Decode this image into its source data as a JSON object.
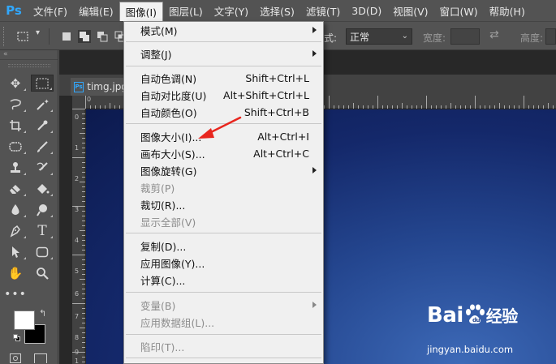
{
  "app": {
    "logo": "Ps"
  },
  "menubar": {
    "items": [
      {
        "label": "文件(F)"
      },
      {
        "label": "编辑(E)"
      },
      {
        "label": "图像(I)",
        "active": true
      },
      {
        "label": "图层(L)"
      },
      {
        "label": "文字(Y)"
      },
      {
        "label": "选择(S)"
      },
      {
        "label": "滤镜(T)"
      },
      {
        "label": "3D(D)"
      },
      {
        "label": "视图(V)"
      },
      {
        "label": "窗口(W)"
      },
      {
        "label": "帮助(H)"
      }
    ]
  },
  "options": {
    "style_label": "式:",
    "style_value": "正常",
    "width_label": "宽度:",
    "height_label": "高度:"
  },
  "document": {
    "tab_name": "timg.jpg",
    "ps_badge": "Ps",
    "ruler_top": [
      "0"
    ],
    "ruler_left": [
      "0",
      "1",
      "2",
      "3",
      "4",
      "5",
      "6",
      "7",
      "8",
      "9",
      "1"
    ]
  },
  "image_menu": {
    "mode": {
      "label": "模式(M)"
    },
    "adjust": {
      "label": "调整(J)"
    },
    "auto_tone": {
      "label": "自动色调(N)",
      "shortcut": "Shift+Ctrl+L"
    },
    "auto_contrast": {
      "label": "自动对比度(U)",
      "shortcut": "Alt+Shift+Ctrl+L"
    },
    "auto_color": {
      "label": "自动颜色(O)",
      "shortcut": "Shift+Ctrl+B"
    },
    "image_size": {
      "label": "图像大小(I)...",
      "shortcut": "Alt+Ctrl+I"
    },
    "canvas_size": {
      "label": "画布大小(S)...",
      "shortcut": "Alt+Ctrl+C"
    },
    "image_rotation": {
      "label": "图像旋转(G)"
    },
    "crop": {
      "label": "裁剪(P)"
    },
    "trim": {
      "label": "裁切(R)..."
    },
    "reveal_all": {
      "label": "显示全部(V)"
    },
    "duplicate": {
      "label": "复制(D)..."
    },
    "apply_image": {
      "label": "应用图像(Y)..."
    },
    "calculations": {
      "label": "计算(C)..."
    },
    "variables": {
      "label": "变量(B)"
    },
    "apply_data_set": {
      "label": "应用数据组(L)..."
    },
    "trap": {
      "label": "陷印(T)..."
    }
  },
  "watermark": {
    "brand": "Bai",
    "brand_suffix": "经验",
    "url": "jingyan.baidu.com"
  },
  "colors": {
    "menubar_bg": "#535353",
    "dropdown_bg": "#f0f0f0",
    "accent_ps": "#31a8ff",
    "annotation_arrow": "#e8261e",
    "canvas_blue": "#14286a"
  }
}
